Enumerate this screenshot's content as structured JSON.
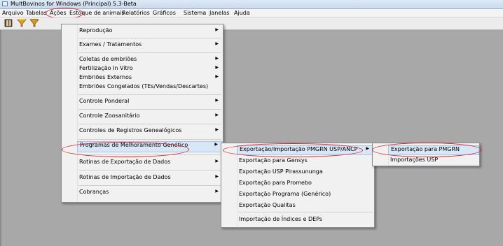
{
  "window": {
    "title": "MultBovinos for Windows (Principal) 5.3-Beta"
  },
  "menubar": [
    "Arquivo",
    "Tabelas",
    "Ações",
    "Estoque de animais",
    "Relatórios",
    "Gráficos",
    "Sistema",
    "Janelas",
    "Ajuda"
  ],
  "toolbar": {
    "icons": [
      "open-book-icon",
      "funnel-icon",
      "funnel-icon"
    ]
  },
  "acoes_menu": {
    "items": [
      {
        "label": "Reprodução",
        "submenu": true
      },
      {
        "label": "Exames / Tratamentos",
        "submenu": true
      },
      {
        "label": "Coletas de embriões",
        "submenu": true
      },
      {
        "label": "Fertilização In Vitro",
        "submenu": true
      },
      {
        "label": "Embriões Externos",
        "submenu": true
      },
      {
        "label": "Embriões Congelados (TEs/Vendas/Descartes)",
        "submenu": false
      },
      {
        "label": "Controle Ponderal",
        "submenu": true
      },
      {
        "label": "Controle Zoosanitário",
        "submenu": true
      },
      {
        "label": "Controles de Registros Genealógicos",
        "submenu": true
      },
      {
        "label": "Programas de Melhoramento Genético",
        "submenu": true
      },
      {
        "label": "Rotinas de Exportação de Dados",
        "submenu": true
      },
      {
        "label": "Rotinas de Importação de Dados",
        "submenu": true
      },
      {
        "label": "Cobranças",
        "submenu": true
      }
    ]
  },
  "programas_menu": {
    "items": [
      {
        "label": "Exportação/Importação PMGRN USP/ANCP",
        "submenu": true
      },
      {
        "label": "Exportação para Gensys",
        "submenu": false
      },
      {
        "label": "Exportação USP Pirassununga",
        "submenu": false
      },
      {
        "label": "Exportação para Promebo",
        "submenu": false
      },
      {
        "label": "Exportação Programa (Genérico)",
        "submenu": false
      },
      {
        "label": "Exportação Qualitas",
        "submenu": false
      },
      {
        "label": "Importação de Índices e DEPs",
        "submenu": false
      }
    ]
  },
  "pmgrn_menu": {
    "items": [
      {
        "label": "Exportação para PMGRN",
        "submenu": false
      },
      {
        "label": "Importações USP",
        "submenu": false
      }
    ]
  },
  "annotation_color": "#d2242a",
  "highlight_color": "#d9e6f6"
}
